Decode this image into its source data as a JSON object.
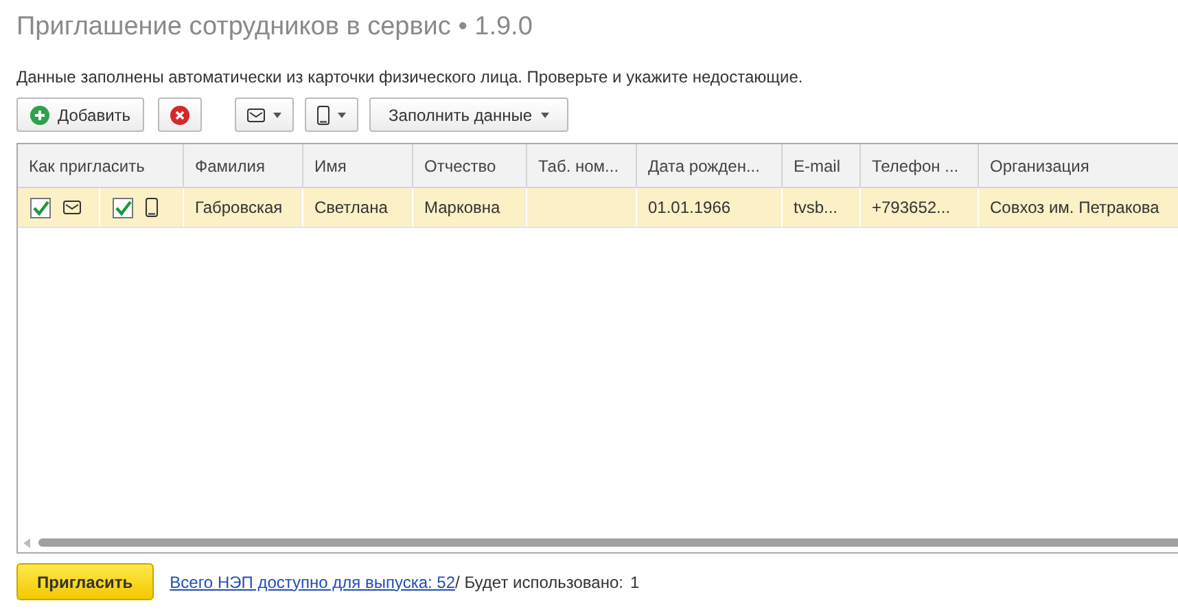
{
  "window": {
    "title": "Приглашение сотрудников в сервис • 1.9.0"
  },
  "info": "Данные заполнены автоматически из карточки физического лица. Проверьте и укажите недостающие.",
  "toolbar": [
    {
      "kind": "add",
      "label": "Добавить"
    },
    {
      "kind": "delete"
    },
    {
      "kind": "mail-menu"
    },
    {
      "kind": "phone-menu"
    },
    {
      "kind": "menu",
      "label": "Заполнить данные"
    }
  ],
  "table": {
    "columns": [
      "Как пригласить",
      "Фамилия",
      "Имя",
      "Отчество",
      "Таб. ном...",
      "Дата рожден...",
      "E-mail",
      "Телефон ...",
      "Организация"
    ],
    "rows": [
      {
        "selected": true,
        "cells": [
          {
            "email_invite": true,
            "phone_invite": true
          },
          "Габровская",
          "Светлана",
          "Марковна",
          "",
          "01.01.1966",
          "tvsb...",
          "+793652...",
          "Совхоз им. Петракова"
        ]
      }
    ]
  },
  "footer": {
    "button": "Пригласить",
    "link": "Всего НЭП доступно для выпуска: 52",
    "text": "/ Будет использовано:",
    "count": "1"
  }
}
